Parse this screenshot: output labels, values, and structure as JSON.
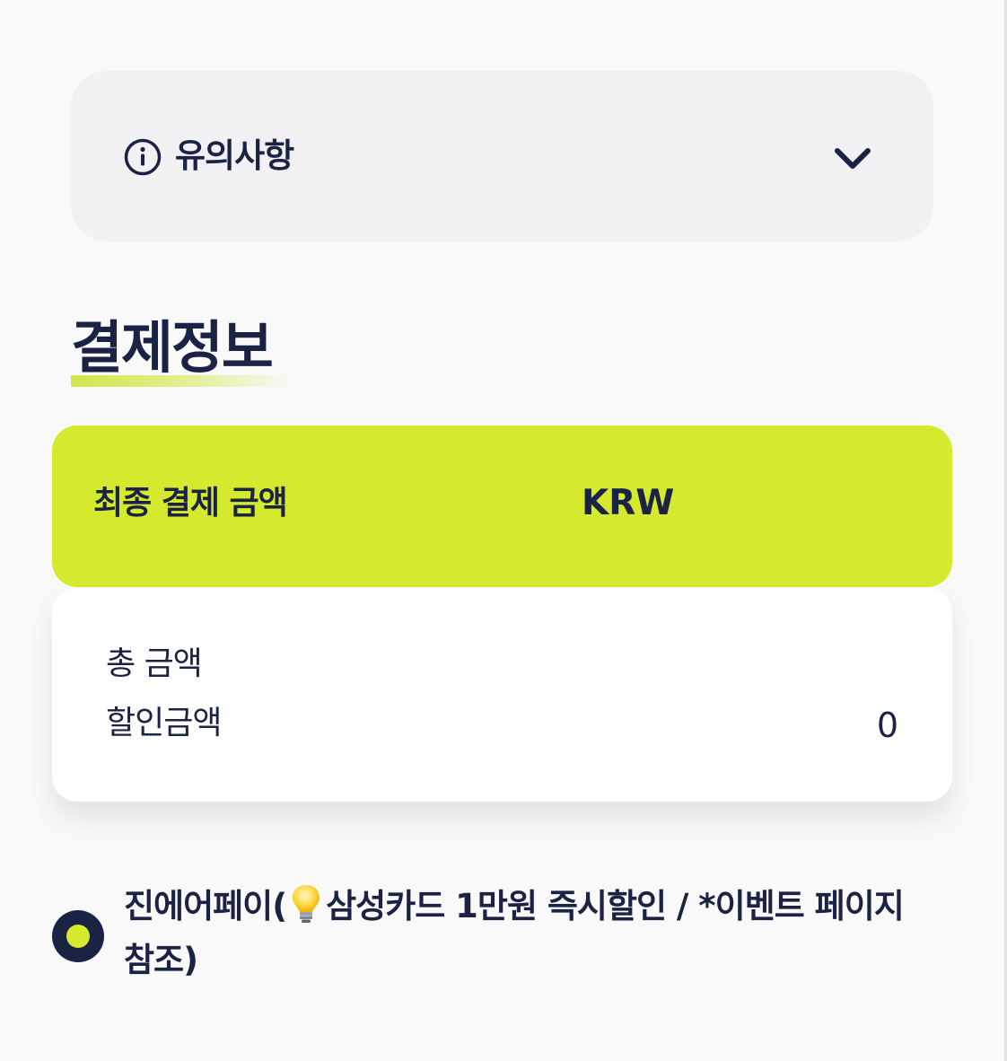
{
  "notice": {
    "title": "유의사항",
    "info_icon": "info-circle-icon",
    "toggle_icon": "chevron-down-icon"
  },
  "payment_info": {
    "heading": "결제정보",
    "final_amount": {
      "label": "최종 결제 금액",
      "currency": "KRW"
    },
    "details": {
      "total_label": "총 금액",
      "discount_label": "할인금액",
      "discount_value": "0"
    }
  },
  "payment_methods": [
    {
      "name": "진에어페이(",
      "icon": "lightbulb-icon",
      "promo": "삼성카드 1만원 즉시할인 / *이벤트 페이지 참조)",
      "selected": true
    }
  ],
  "colors": {
    "accent": "#d5ea2f",
    "navy": "#1a2344",
    "notice_bg": "#f1f1f3",
    "page_bg": "#f9f9f9"
  }
}
